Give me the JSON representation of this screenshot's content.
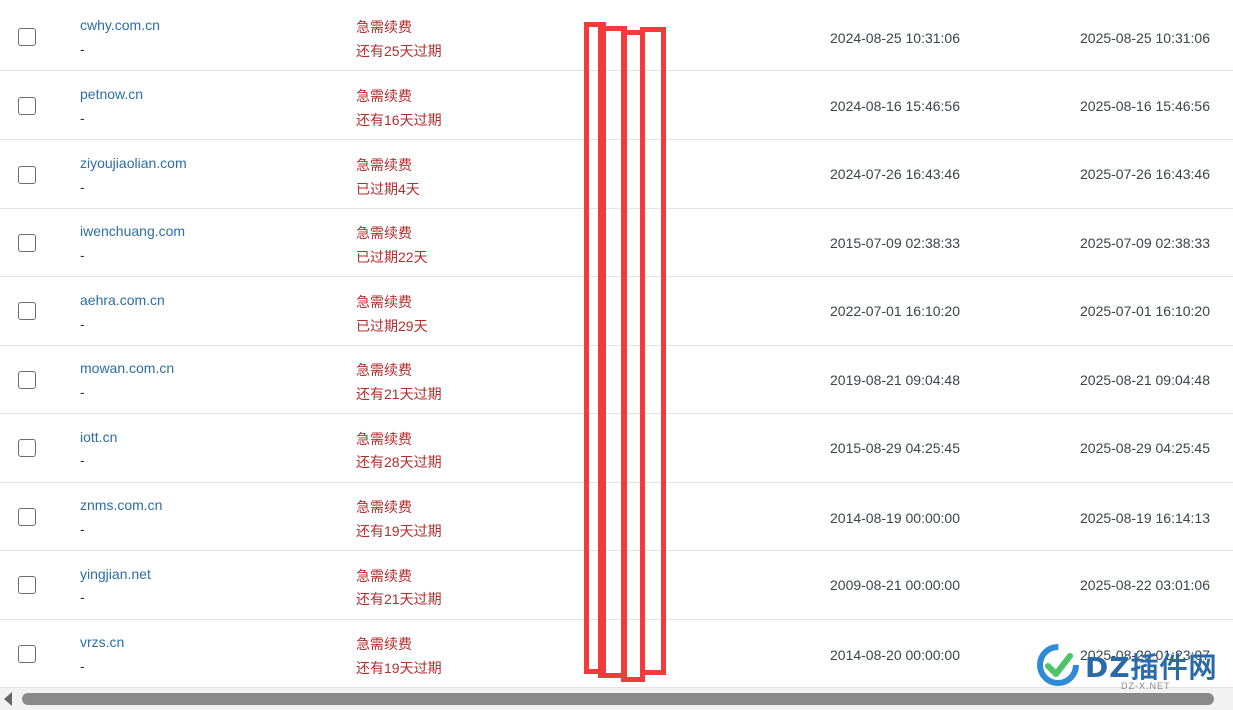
{
  "rows": [
    {
      "domain": "cwhy.com.cn",
      "note": "-",
      "status": "急需续费",
      "expiry_note": "还有25天过期",
      "registered": "2024-08-25 10:31:06",
      "expires": "2025-08-25 10:31:06"
    },
    {
      "domain": "petnow.cn",
      "note": "-",
      "status": "急需续费",
      "expiry_note": "还有16天过期",
      "registered": "2024-08-16 15:46:56",
      "expires": "2025-08-16 15:46:56"
    },
    {
      "domain": "ziyoujiaolian.com",
      "note": "-",
      "status": "急需续费",
      "expiry_note": "已过期4天",
      "registered": "2024-07-26 16:43:46",
      "expires": "2025-07-26 16:43:46"
    },
    {
      "domain": "iwenchuang.com",
      "note": "-",
      "status": "急需续费",
      "expiry_note": "已过期22天",
      "registered": "2015-07-09 02:38:33",
      "expires": "2025-07-09 02:38:33"
    },
    {
      "domain": "aehra.com.cn",
      "note": "-",
      "status": "急需续费",
      "expiry_note": "已过期29天",
      "registered": "2022-07-01 16:10:20",
      "expires": "2025-07-01 16:10:20"
    },
    {
      "domain": "mowan.com.cn",
      "note": "-",
      "status": "急需续费",
      "expiry_note": "还有21天过期",
      "registered": "2019-08-21 09:04:48",
      "expires": "2025-08-21 09:04:48"
    },
    {
      "domain": "iott.cn",
      "note": "-",
      "status": "急需续费",
      "expiry_note": "还有28天过期",
      "registered": "2015-08-29 04:25:45",
      "expires": "2025-08-29 04:25:45"
    },
    {
      "domain": "znms.com.cn",
      "note": "-",
      "status": "急需续费",
      "expiry_note": "还有19天过期",
      "registered": "2014-08-19 00:00:00",
      "expires": "2025-08-19 16:14:13"
    },
    {
      "domain": "yingjian.net",
      "note": "-",
      "status": "急需续费",
      "expiry_note": "还有21天过期",
      "registered": "2009-08-21 00:00:00",
      "expires": "2025-08-22 03:01:06"
    },
    {
      "domain": "vrzs.cn",
      "note": "-",
      "status": "急需续费",
      "expiry_note": "还有19天过期",
      "registered": "2014-08-20 00:00:00",
      "expires": "2025-08-20 01:23:07"
    }
  ],
  "watermark": {
    "brand": "DZ插件网",
    "sub": "DZ-X.NET"
  },
  "colors": {
    "link": "#2a6ea6",
    "status": "#b32d2e",
    "redaction": "#f23b3b"
  }
}
